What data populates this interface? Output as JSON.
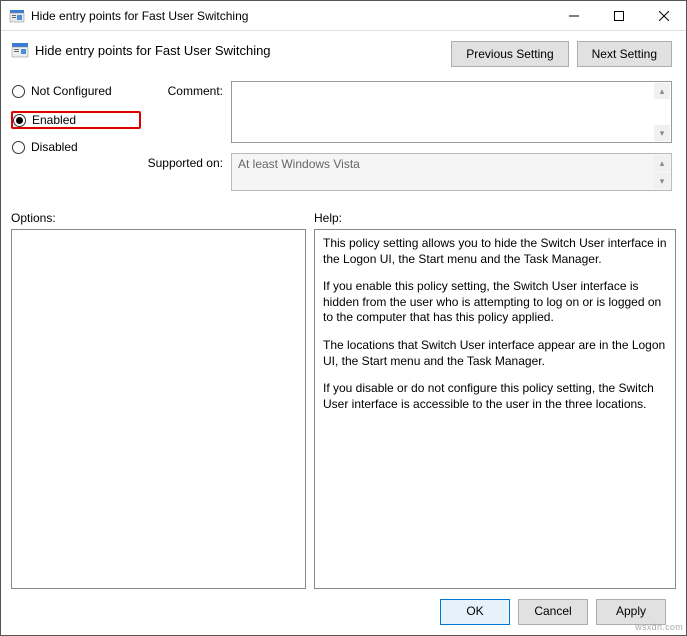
{
  "window": {
    "title": "Hide entry points for Fast User Switching"
  },
  "header": {
    "title": "Hide entry points for Fast User Switching",
    "previous": "Previous Setting",
    "next": "Next Setting"
  },
  "state": {
    "not_configured": "Not Configured",
    "enabled": "Enabled",
    "disabled": "Disabled",
    "selected": "enabled"
  },
  "fields": {
    "comment_label": "Comment:",
    "comment_value": "",
    "supported_label": "Supported on:",
    "supported_value": "At least Windows Vista"
  },
  "lower": {
    "options_label": "Options:",
    "help_label": "Help:",
    "help_paragraphs": [
      "This policy setting allows you to hide the Switch User interface in the Logon UI, the Start menu and the Task Manager.",
      "If you enable this policy setting, the Switch User interface is hidden from the user who is attempting to log on or is logged on to the computer that has this policy applied.",
      "The locations that Switch User interface appear are in the Logon UI, the Start menu and the Task Manager.",
      "If you disable or do not configure this policy setting, the Switch User interface is accessible to the user in the three locations."
    ]
  },
  "footer": {
    "ok": "OK",
    "cancel": "Cancel",
    "apply": "Apply"
  },
  "watermark": "wsxdn.com"
}
